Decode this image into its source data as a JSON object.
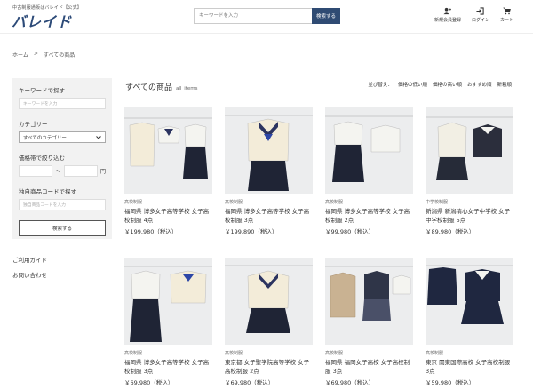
{
  "header": {
    "logo_sub": "中古制服通販はバレイド【公式】",
    "logo": "バレイド",
    "search_placeholder": "キーワードを入力",
    "search_button": "検索する",
    "icons": [
      {
        "label": "新規会員登録",
        "icon": "user-plus-icon"
      },
      {
        "label": "ログイン",
        "icon": "login-icon"
      },
      {
        "label": "カート",
        "icon": "cart-icon"
      }
    ]
  },
  "breadcrumb": {
    "home": "ホーム",
    "sep": ">",
    "current": "すべての商品"
  },
  "sidebar": {
    "keyword_label": "キーワードで探す",
    "keyword_placeholder": "キーワードを入力",
    "category_label": "カテゴリー",
    "category_value": "すべてのカテゴリー",
    "price_label": "価格帯で絞り込む",
    "price_sep": "〜",
    "price_unit": "円",
    "code_label": "独自商品コードで探す",
    "code_placeholder": "独自商品コードを入力",
    "search_button": "検索する"
  },
  "links": {
    "guide": "ご利用ガイド",
    "contact": "お問い合わせ"
  },
  "main": {
    "title": "すべての商品",
    "subtitle": "all_items",
    "sort": {
      "label": "並び替え：",
      "options": [
        "価格の低い順",
        "価格の高い順",
        "おすすめ順",
        "新着順"
      ]
    }
  },
  "products": [
    {
      "category": "高校制服",
      "name": "福岡県 博多女子高等学校 女子高校制服 4点",
      "price": "￥199,980（税込）"
    },
    {
      "category": "高校制服",
      "name": "福岡県 博多女子高等学校 女子高校制服 3点",
      "price": "￥199,890（税込）"
    },
    {
      "category": "高校制服",
      "name": "福岡県 博多女子高等学校 女子高校制服 2点",
      "price": "￥99,980（税込）"
    },
    {
      "category": "中学校制服",
      "name": "新潟県 新潟清心女子中学校 女子中学校制服 5点",
      "price": "￥89,980（税込）"
    },
    {
      "category": "高校制服",
      "name": "福岡県 博多女子高等学校 女子高校制服 3点",
      "price": "￥69,980（税込）"
    },
    {
      "category": "高校制服",
      "name": "東京都 女子聖学院高等学校 女子高校制服 2点",
      "price": "￥69,980（税込）"
    },
    {
      "category": "高校制服",
      "name": "福岡県 福岡女子高校 女子高校制服 3点",
      "price": "￥69,980（税込）"
    },
    {
      "category": "高校制服",
      "name": "東京 関東国際高校 女子高校制服 3点",
      "price": "￥59,980（税込）"
    }
  ],
  "colors": {
    "accent": "#2f4b73",
    "logo": "#2c4a78",
    "sidebar_bg": "#f2f2f2"
  }
}
